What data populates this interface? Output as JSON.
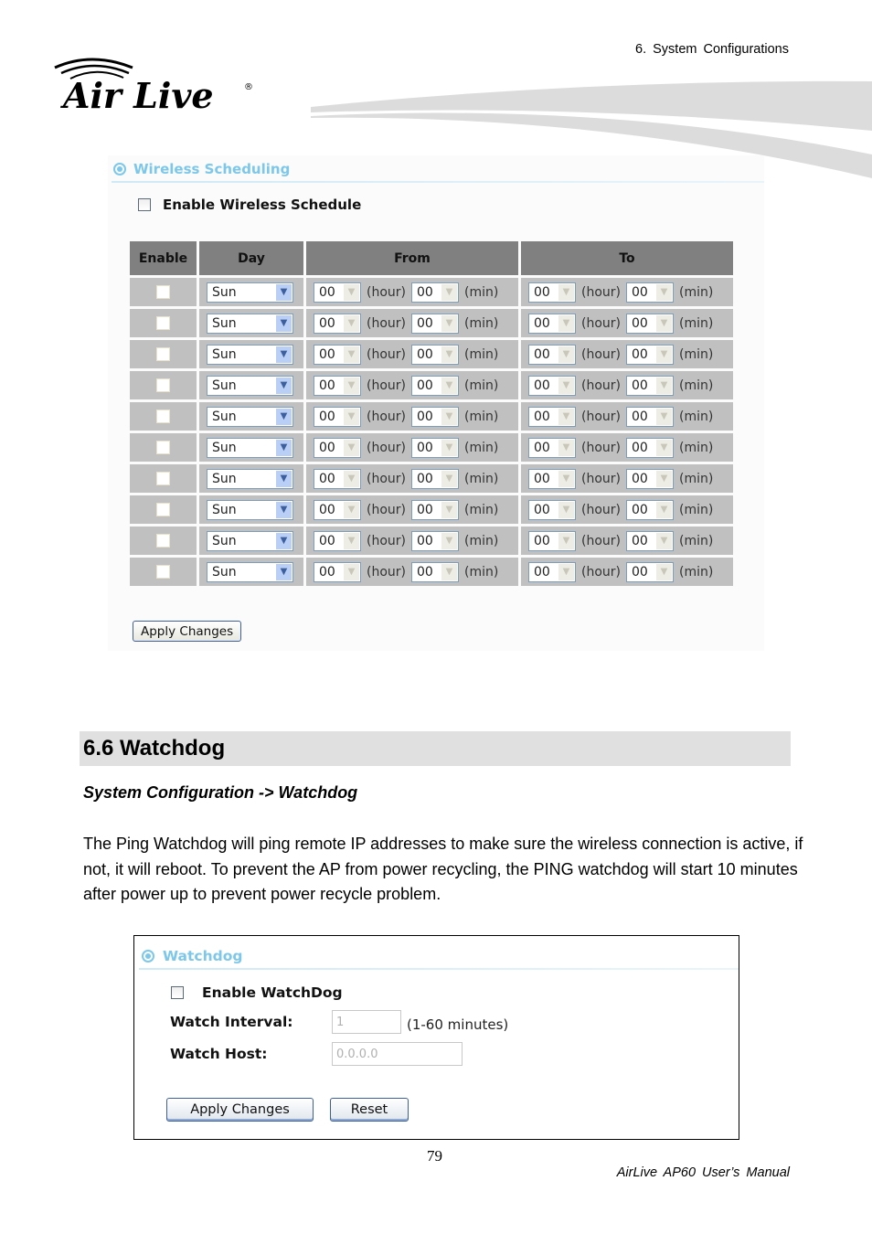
{
  "header": {
    "chapter": "6.  System  Configurations",
    "logo_text": "Air Live",
    "logo_mark": "®"
  },
  "wireless_scheduling": {
    "title": "Wireless Scheduling",
    "enable_label": "Enable Wireless Schedule",
    "enable_checked": false,
    "columns": [
      "Enable",
      "Day",
      "From",
      "To"
    ],
    "hour_unit": "(hour)",
    "min_unit": "(min)",
    "rows": [
      {
        "enabled": false,
        "day": "Sun",
        "from_hour": "00",
        "from_min": "00",
        "to_hour": "00",
        "to_min": "00"
      },
      {
        "enabled": false,
        "day": "Sun",
        "from_hour": "00",
        "from_min": "00",
        "to_hour": "00",
        "to_min": "00"
      },
      {
        "enabled": false,
        "day": "Sun",
        "from_hour": "00",
        "from_min": "00",
        "to_hour": "00",
        "to_min": "00"
      },
      {
        "enabled": false,
        "day": "Sun",
        "from_hour": "00",
        "from_min": "00",
        "to_hour": "00",
        "to_min": "00"
      },
      {
        "enabled": false,
        "day": "Sun",
        "from_hour": "00",
        "from_min": "00",
        "to_hour": "00",
        "to_min": "00"
      },
      {
        "enabled": false,
        "day": "Sun",
        "from_hour": "00",
        "from_min": "00",
        "to_hour": "00",
        "to_min": "00"
      },
      {
        "enabled": false,
        "day": "Sun",
        "from_hour": "00",
        "from_min": "00",
        "to_hour": "00",
        "to_min": "00"
      },
      {
        "enabled": false,
        "day": "Sun",
        "from_hour": "00",
        "from_min": "00",
        "to_hour": "00",
        "to_min": "00"
      },
      {
        "enabled": false,
        "day": "Sun",
        "from_hour": "00",
        "from_min": "00",
        "to_hour": "00",
        "to_min": "00"
      },
      {
        "enabled": false,
        "day": "Sun",
        "from_hour": "00",
        "from_min": "00",
        "to_hour": "00",
        "to_min": "00"
      }
    ],
    "apply_label": "Apply Changes"
  },
  "section": {
    "title": "6.6 Watchdog",
    "nav_path": "System Configuration -> Watchdog",
    "paragraph": "The Ping Watchdog will ping remote IP addresses to make sure the wireless connection is active, if not, it will reboot. To prevent the AP from power recycling, the PING watchdog will start 10 minutes after power up to prevent power recycle problem."
  },
  "watchdog": {
    "title": "Watchdog",
    "enable_label": "Enable WatchDog",
    "enable_checked": false,
    "interval_label": "Watch Interval:",
    "interval_value": "1",
    "interval_hint": "(1-60 minutes)",
    "host_label": "Watch Host:",
    "host_value": "0.0.0.0",
    "apply_label": "Apply Changes",
    "reset_label": "Reset"
  },
  "footer": {
    "page_number": "79",
    "manual": "AirLive  AP60  User’s  Manual"
  }
}
